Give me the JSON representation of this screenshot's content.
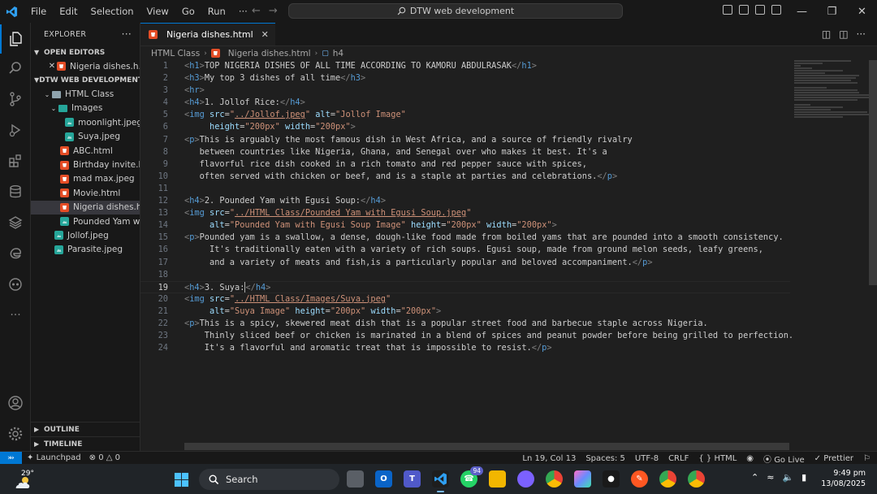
{
  "menu": [
    "File",
    "Edit",
    "Selection",
    "View",
    "Go",
    "Run",
    "···"
  ],
  "command_center": "DTW web development",
  "explorer": {
    "title": "EXPLORER",
    "more": "···",
    "open_editors_title": "OPEN EDITORS",
    "open_editor_item": "Nigeria dishes.h...",
    "workspace_title": "DTW WEB DEVELOPMENT",
    "folder_html_class": "HTML Class",
    "folder_images": "Images",
    "files_images": [
      "moonlight.jpeg",
      "Suya.jpeg"
    ],
    "files_html_class": [
      {
        "name": "ABC.html",
        "type": "html"
      },
      {
        "name": "Birthday invite.h...",
        "type": "html"
      },
      {
        "name": "mad max.jpeg",
        "type": "html"
      },
      {
        "name": "Movie.html",
        "type": "html"
      },
      {
        "name": "Nigeria dishes.h...",
        "type": "html",
        "selected": true
      },
      {
        "name": "Pounded Yam wi...",
        "type": "img"
      }
    ],
    "files_root": [
      "Jollof.jpeg",
      "Parasite.jpeg"
    ],
    "outline_title": "OUTLINE",
    "timeline_title": "TIMELINE"
  },
  "tab": {
    "label": "Nigeria dishes.html"
  },
  "breadcrumbs": [
    "HTML Class",
    "Nigeria dishes.html",
    "h4"
  ],
  "code_lines": [
    {
      "n": "1",
      "s": [
        [
          "tag",
          "<"
        ],
        [
          "name",
          "h1"
        ],
        [
          "tag",
          ">"
        ],
        [
          "text",
          "TOP NIGERIA DISHES OF ALL TIME ACCORDING TO KAMORU ABDULRASAK"
        ],
        [
          "tag",
          "</"
        ],
        [
          "name",
          "h1"
        ],
        [
          "tag",
          ">"
        ]
      ]
    },
    {
      "n": "2",
      "s": [
        [
          "tag",
          "<"
        ],
        [
          "name",
          "h3"
        ],
        [
          "tag",
          ">"
        ],
        [
          "text",
          "My top 3 dishes of all time"
        ],
        [
          "tag",
          "</"
        ],
        [
          "name",
          "h3"
        ],
        [
          "tag",
          ">"
        ]
      ]
    },
    {
      "n": "3",
      "s": [
        [
          "tag",
          "<"
        ],
        [
          "name",
          "hr"
        ],
        [
          "tag",
          ">"
        ]
      ]
    },
    {
      "n": "4",
      "s": [
        [
          "tag",
          "<"
        ],
        [
          "name",
          "h4"
        ],
        [
          "tag",
          ">"
        ],
        [
          "text",
          "1. Jollof Rice:"
        ],
        [
          "tag",
          "</"
        ],
        [
          "name",
          "h4"
        ],
        [
          "tag",
          ">"
        ]
      ]
    },
    {
      "n": "5",
      "s": [
        [
          "tag",
          "<"
        ],
        [
          "name",
          "img"
        ],
        [
          "text",
          " "
        ],
        [
          "attr",
          "src"
        ],
        [
          "text",
          "="
        ],
        [
          "str",
          "\""
        ],
        [
          "link",
          "../Jollof.jpeg"
        ],
        [
          "str",
          "\""
        ],
        [
          "text",
          " "
        ],
        [
          "attr",
          "alt"
        ],
        [
          "text",
          "="
        ],
        [
          "str",
          "\"Jollof Image\""
        ]
      ]
    },
    {
      "n": "6",
      "s": [
        [
          "text",
          "     "
        ],
        [
          "attr",
          "height"
        ],
        [
          "text",
          "="
        ],
        [
          "str",
          "\"200px\""
        ],
        [
          "text",
          " "
        ],
        [
          "attr",
          "width"
        ],
        [
          "text",
          "="
        ],
        [
          "str",
          "\"200px\""
        ],
        [
          "tag",
          ">"
        ]
      ]
    },
    {
      "n": "7",
      "s": [
        [
          "tag",
          "<"
        ],
        [
          "name",
          "p"
        ],
        [
          "tag",
          ">"
        ],
        [
          "text",
          "This is arguably the most famous dish in West Africa, and a source of friendly rivalry"
        ]
      ]
    },
    {
      "n": "8",
      "s": [
        [
          "text",
          "   between countries like Nigeria, Ghana, and Senegal over who makes it best. It's a"
        ]
      ]
    },
    {
      "n": "9",
      "s": [
        [
          "text",
          "   flavorful rice dish cooked in a rich tomato and red pepper sauce with spices,"
        ]
      ]
    },
    {
      "n": "10",
      "s": [
        [
          "text",
          "   often served with chicken or beef, and is a staple at parties and celebrations."
        ],
        [
          "tag",
          "</"
        ],
        [
          "name",
          "p"
        ],
        [
          "tag",
          ">"
        ]
      ]
    },
    {
      "n": "11",
      "s": []
    },
    {
      "n": "12",
      "s": [
        [
          "tag",
          "<"
        ],
        [
          "name",
          "h4"
        ],
        [
          "tag",
          ">"
        ],
        [
          "text",
          "2. Pounded Yam with Egusi Soup:"
        ],
        [
          "tag",
          "</"
        ],
        [
          "name",
          "h4"
        ],
        [
          "tag",
          ">"
        ]
      ]
    },
    {
      "n": "13",
      "s": [
        [
          "tag",
          "<"
        ],
        [
          "name",
          "img"
        ],
        [
          "text",
          " "
        ],
        [
          "attr",
          "src"
        ],
        [
          "text",
          "="
        ],
        [
          "str",
          "\""
        ],
        [
          "link",
          "../HTML Class/Pounded Yam with Egusi Soup.jpeg"
        ],
        [
          "str",
          "\""
        ]
      ]
    },
    {
      "n": "14",
      "s": [
        [
          "text",
          "     "
        ],
        [
          "attr",
          "alt"
        ],
        [
          "text",
          "="
        ],
        [
          "str",
          "\"Pounded Yam with Egusi Soup Image\""
        ],
        [
          "text",
          " "
        ],
        [
          "attr",
          "height"
        ],
        [
          "text",
          "="
        ],
        [
          "str",
          "\"200px\""
        ],
        [
          "text",
          " "
        ],
        [
          "attr",
          "width"
        ],
        [
          "text",
          "="
        ],
        [
          "str",
          "\"200px\""
        ],
        [
          "tag",
          ">"
        ]
      ]
    },
    {
      "n": "15",
      "s": [
        [
          "tag",
          "<"
        ],
        [
          "name",
          "p"
        ],
        [
          "tag",
          ">"
        ],
        [
          "text",
          "Pounded yam is a swallow, a dense, dough-like food made from boiled yams that are pounded into a smooth consistency."
        ]
      ]
    },
    {
      "n": "16",
      "s": [
        [
          "text",
          "     It's traditionally eaten with a variety of rich soups. Egusi soup, made from ground melon seeds, leafy greens,"
        ]
      ]
    },
    {
      "n": "17",
      "s": [
        [
          "text",
          "     and a variety of meats and fish,is a particularly popular and beloved accompaniment."
        ],
        [
          "tag",
          "</"
        ],
        [
          "name",
          "p"
        ],
        [
          "tag",
          ">"
        ]
      ]
    },
    {
      "n": "18",
      "s": []
    },
    {
      "n": "19",
      "s": [
        [
          "tag",
          "<"
        ],
        [
          "name",
          "h4"
        ],
        [
          "tag",
          ">"
        ],
        [
          "text",
          "3. Suya:"
        ],
        [
          "cursor",
          ""
        ],
        [
          "tag",
          "</"
        ],
        [
          "name",
          "h4"
        ],
        [
          "tag",
          ">"
        ]
      ],
      "current": true
    },
    {
      "n": "20",
      "s": [
        [
          "tag",
          "<"
        ],
        [
          "name",
          "img"
        ],
        [
          "text",
          " "
        ],
        [
          "attr",
          "src"
        ],
        [
          "text",
          "="
        ],
        [
          "str",
          "\""
        ],
        [
          "link",
          "../HTML Class/Images/Suya.jpeg"
        ],
        [
          "str",
          "\""
        ]
      ]
    },
    {
      "n": "21",
      "s": [
        [
          "text",
          "     "
        ],
        [
          "attr",
          "alt"
        ],
        [
          "text",
          "="
        ],
        [
          "str",
          "\"Suya Image\""
        ],
        [
          "text",
          " "
        ],
        [
          "attr",
          "height"
        ],
        [
          "text",
          "="
        ],
        [
          "str",
          "\"200px\""
        ],
        [
          "text",
          " "
        ],
        [
          "attr",
          "width"
        ],
        [
          "text",
          "="
        ],
        [
          "str",
          "\"200px\""
        ],
        [
          "tag",
          ">"
        ]
      ]
    },
    {
      "n": "22",
      "s": [
        [
          "tag",
          "<"
        ],
        [
          "name",
          "p"
        ],
        [
          "tag",
          ">"
        ],
        [
          "text",
          "This is a spicy, skewered meat dish that is a popular street food and barbecue staple across Nigeria."
        ]
      ]
    },
    {
      "n": "23",
      "s": [
        [
          "text",
          "    Thinly sliced beef or chicken is marinated in a blend of spices and peanut powder before being grilled to perfection."
        ]
      ]
    },
    {
      "n": "24",
      "s": [
        [
          "text",
          "    It's a flavorful and aromatic treat that is impossible to resist."
        ],
        [
          "tag",
          "</"
        ],
        [
          "name",
          "p"
        ],
        [
          "tag",
          ">"
        ]
      ]
    }
  ],
  "status": {
    "launchpad": "Launchpad",
    "errors": "0",
    "warnings": "0",
    "position": "Ln 19, Col 13",
    "spaces": "Spaces: 5",
    "encoding": "UTF-8",
    "eol": "CRLF",
    "language": "HTML",
    "golive": "Go Live",
    "prettier": "Prettier"
  },
  "taskbar": {
    "temperature": "29°",
    "search_label": "Search",
    "whatsapp_badge": "94",
    "time": "9:49 pm",
    "date": "13/08/2025"
  },
  "colors": {
    "accent": "#0078d4",
    "html_icon": "#e44d26",
    "image_icon": "#26a69a"
  }
}
